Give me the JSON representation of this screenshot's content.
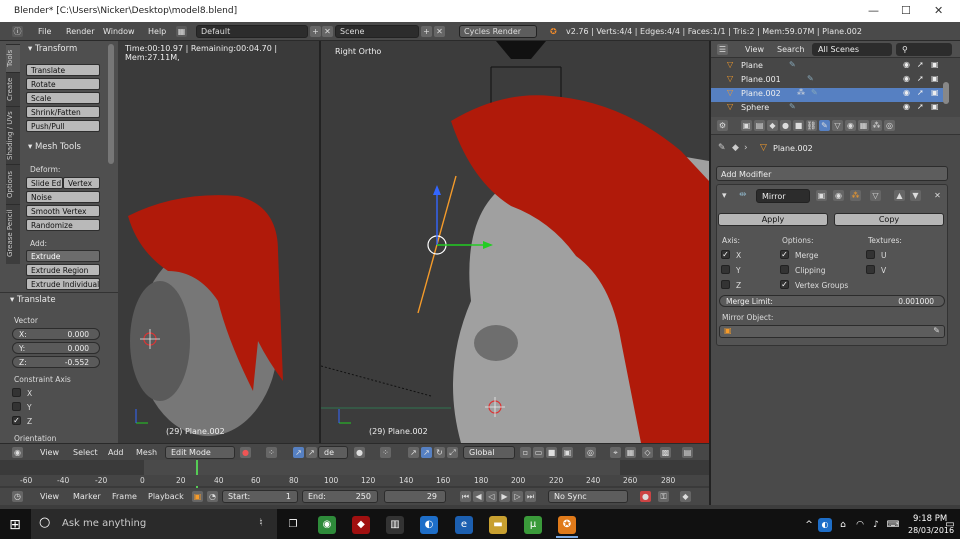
{
  "window": {
    "title": "Blender* [C:\\Users\\Nicker\\Desktop\\model8.blend]",
    "min_glyph": "—",
    "max_glyph": "☐",
    "close_glyph": "✕"
  },
  "menubar": {
    "items": [
      "File",
      "Render",
      "Window",
      "Help"
    ],
    "layout": "Default",
    "scene": "Scene",
    "engine": "Cycles Render",
    "stats": "v2.76 | Verts:4/4 | Edges:4/4 | Faces:1/1 | Tris:2 | Mem:59.07M | Plane.002"
  },
  "toolshelf": {
    "tabs": [
      "Tools",
      "Create",
      "Shading / UVs",
      "Options",
      "Grease Pencil"
    ],
    "transform_title": "Transform",
    "transform_buttons": [
      "Translate",
      "Rotate",
      "Scale",
      "Shrink/Fatten",
      "Push/Pull"
    ],
    "mesh_tools_title": "Mesh Tools",
    "deform_label": "Deform:",
    "slide_edge": "Slide Ed",
    "vertex": "Vertex",
    "noise": "Noise",
    "smooth_vertex": "Smooth Vertex",
    "randomize": "Randomize",
    "add_label": "Add:",
    "extrude": "Extrude",
    "extrude_region": "Extrude Region",
    "extrude_individual": "Extrude Individual",
    "translate_title": "Translate",
    "vector_label": "Vector",
    "x_label": "X:",
    "x_value": "0.000",
    "y_label": "Y:",
    "y_value": "0.000",
    "z_label": "Z:",
    "z_value": "-0.552",
    "constraint_label": "Constraint Axis",
    "cx": "X",
    "cy": "Y",
    "cz": "Z",
    "orientation_label": "Orientation"
  },
  "viewport": {
    "time_info": "Time:00:10.97 | Remaining:00:04.70 | Mem:27.11M,",
    "view_name": "Right Ortho",
    "left_object": "(29) Plane.002",
    "right_object": "(29) Plane.002"
  },
  "viewheader": {
    "items": [
      "View",
      "Select",
      "Add",
      "Mesh"
    ],
    "mode": "Edit Mode",
    "pivot_label": "de",
    "orientation": "Global"
  },
  "timeline": {
    "ticks": [
      "-60",
      "-40",
      "-20",
      "0",
      "20",
      "40",
      "60",
      "80",
      "100",
      "120",
      "140",
      "160",
      "180",
      "200",
      "220",
      "240",
      "260",
      "280"
    ],
    "items": [
      "View",
      "Marker",
      "Frame",
      "Playback"
    ],
    "start_label": "Start:",
    "start_value": "1",
    "end_label": "End:",
    "end_value": "250",
    "current": "29",
    "sync": "No Sync"
  },
  "outliner": {
    "view": "View",
    "search": "Search",
    "scenes": "All Scenes",
    "rows": [
      "Plane",
      "Plane.001",
      "Plane.002",
      "Sphere"
    ]
  },
  "properties": {
    "object": "Plane.002",
    "add_modifier": "Add Modifier",
    "modifier_name": "Mirror",
    "apply": "Apply",
    "copy": "Copy",
    "axis_label": "Axis:",
    "options_label": "Options:",
    "textures_label": "Textures:",
    "ax": "X",
    "ay": "Y",
    "az": "Z",
    "merge": "Merge",
    "clipping": "Clipping",
    "vertex_groups": "Vertex Groups",
    "tu": "U",
    "tv": "V",
    "merge_limit_label": "Merge Limit:",
    "merge_limit_value": "0.001000",
    "mirror_object_label": "Mirror Object:"
  },
  "taskbar": {
    "search": "Ask me anything",
    "time": "9:18 PM",
    "date": "28/03/2016"
  },
  "colors": {
    "accent_blue": "#5680c2",
    "hair_red": "#b01a0a",
    "select_orange": "#f59b2a",
    "axis_green": "#22cc33"
  }
}
